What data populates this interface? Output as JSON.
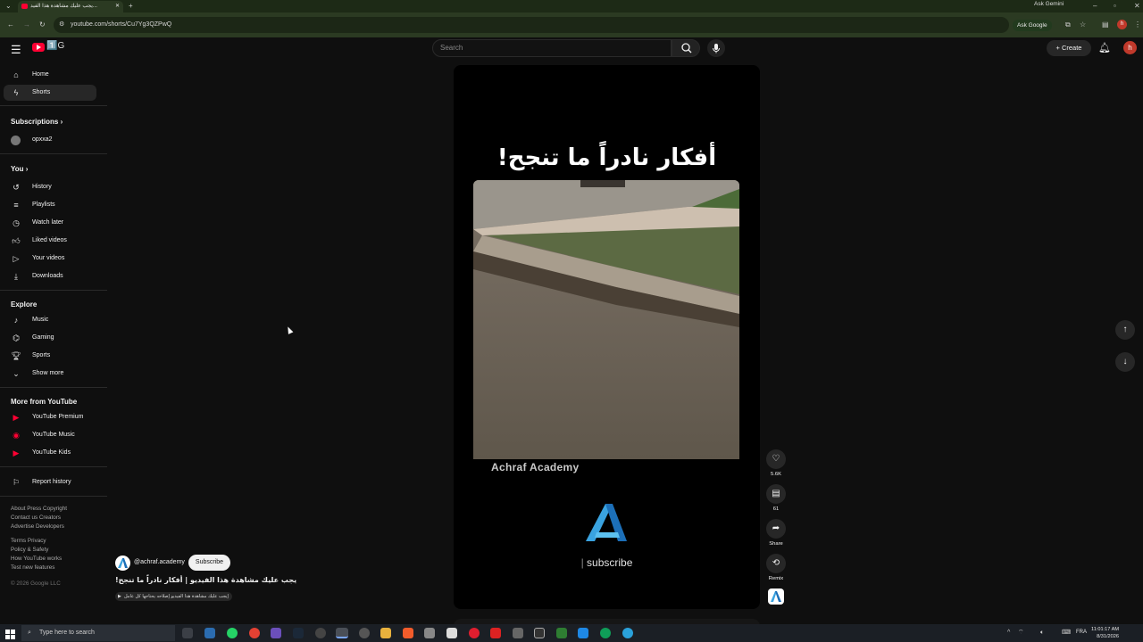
{
  "browser": {
    "tab_title": "يجب عليك مشاهدة هذا الفيد...",
    "url": "youtube.com/shorts/Cu7Yg3QZPwQ",
    "gemini_label": "Ask Gemini",
    "ask_google_label": "Ask Google",
    "profile_initial": "h"
  },
  "masthead": {
    "logo_text": "1️⃣G",
    "search_placeholder": "Search",
    "create_label": "Create",
    "avatar_initial": "h"
  },
  "sidebar": {
    "main": [
      {
        "label": "Home",
        "icon": "home-icon"
      },
      {
        "label": "Shorts",
        "icon": "shorts-icon",
        "active": true
      }
    ],
    "subscriptions_title": "Subscriptions",
    "subscriptions": [
      {
        "label": "opxxa2"
      }
    ],
    "you_title": "You",
    "you_items": [
      "History",
      "Playlists",
      "Watch later",
      "Liked videos",
      "Your videos",
      "Downloads"
    ],
    "explore_title": "Explore",
    "explore_items": [
      "Music",
      "Gaming",
      "Sports",
      "Show more"
    ],
    "more_title": "More from YouTube",
    "more_items": [
      "YouTube Premium",
      "YouTube Music",
      "YouTube Kids"
    ],
    "report_history": "Report history",
    "footer": {
      "line1": "About  Press  Copyright",
      "line2": "Contact us  Creators",
      "line3": "Advertise  Developers",
      "line4": "Terms  Privacy",
      "line5": "Policy & Safety",
      "line6": "How YouTube works",
      "line7": "Test new features",
      "copyright": "© 2026 Google LLC"
    }
  },
  "short": {
    "overlay_title": "أفكار نادراً ما تنجح!",
    "watermark": "Achraf Academy",
    "subscribe_text": "subscribe",
    "likes": "5.6K",
    "comments": "61",
    "share_label": "Share",
    "remix_label": "Remix"
  },
  "channel": {
    "handle": "@achraf.academy",
    "subscribe_label": "Subscribe",
    "video_title": "يجب عليك مشاهدة هذا الفيديو | أفكار نادراً ما تنجح!",
    "sub_chip": "إيجب عليك مشاهدة هذا الفيديو إصلاحه يحتاجها كل عامل"
  },
  "taskbar": {
    "search_placeholder": "Type here to search",
    "lang": "FRA",
    "time": "11:01:17 AM",
    "date": "8/31/2026"
  },
  "colors": {
    "accent": "#ff0033",
    "bg": "#0f0f0f",
    "chip": "#272727"
  }
}
